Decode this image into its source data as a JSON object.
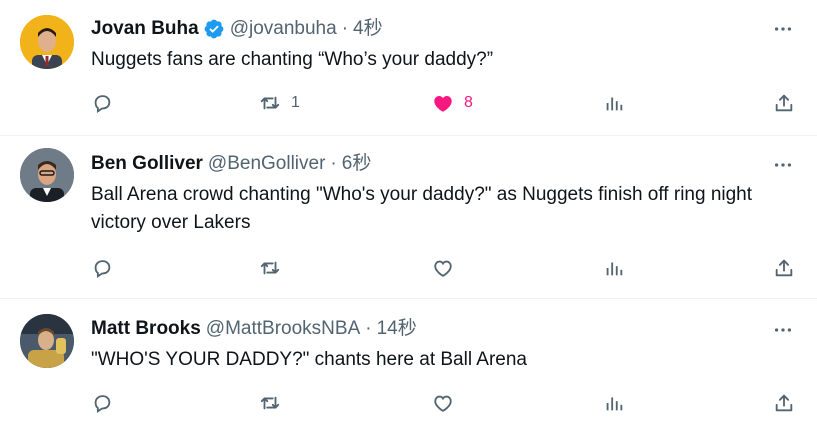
{
  "tweets": [
    {
      "name": "Jovan Buha",
      "verified": true,
      "handle": "@jovanbuha",
      "separator": "·",
      "time": "4秒",
      "text": "Nuggets fans are chanting “Who’s your daddy?”",
      "retweets": "1",
      "likes": "8",
      "liked": true
    },
    {
      "name": "Ben Golliver",
      "verified": false,
      "handle": "@BenGolliver",
      "separator": "·",
      "time": "6秒",
      "text": "Ball Arena crowd chanting \"Who's your daddy?\" as Nuggets finish off ring night victory over Lakers",
      "retweets": "",
      "likes": "",
      "liked": false
    },
    {
      "name": "Matt Brooks",
      "verified": false,
      "handle": "@MattBrooksNBA",
      "separator": "·",
      "time": "14秒",
      "text": "\"WHO'S YOUR DADDY?\" chants here at Ball Arena",
      "retweets": "",
      "likes": "",
      "liked": false
    }
  ],
  "colors": {
    "text": "#0f1419",
    "secondary": "#536471",
    "like": "#f91880",
    "verified": "#1d9bf0",
    "divider": "#eff3f4"
  },
  "icons": [
    "reply-icon",
    "retweet-icon",
    "like-icon",
    "views-icon",
    "share-icon",
    "more-icon",
    "verified-badge-icon"
  ]
}
